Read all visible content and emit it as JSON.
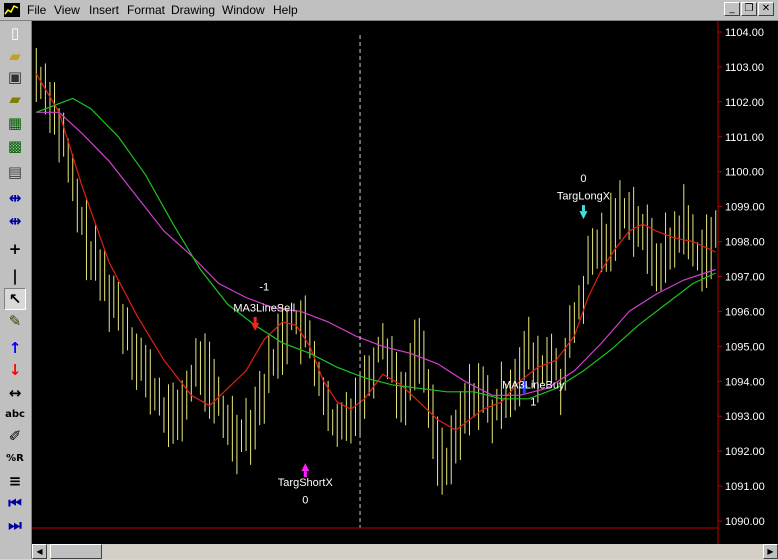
{
  "menu": {
    "items": [
      {
        "label": "File",
        "name": "menu-file"
      },
      {
        "label": "View",
        "name": "menu-view"
      },
      {
        "label": "Insert",
        "name": "menu-insert"
      },
      {
        "label": "Format",
        "name": "menu-format"
      },
      {
        "label": "Drawing",
        "name": "menu-drawing"
      },
      {
        "label": "Window",
        "name": "menu-window"
      },
      {
        "label": "Help",
        "name": "menu-help"
      }
    ]
  },
  "window_controls": [
    "minimize",
    "restore",
    "close"
  ],
  "toolbar": {
    "tools": [
      {
        "icon": "new-document-icon",
        "glyph": "▯",
        "color": "#ffffff"
      },
      {
        "icon": "open-folder-icon",
        "glyph": "▰",
        "color": "#c8a020"
      },
      {
        "icon": "save-stack-icon",
        "glyph": "▣",
        "color": "#303030"
      },
      {
        "icon": "open-workspace-icon",
        "glyph": "▰",
        "color": "#808000"
      },
      {
        "icon": "chart-window-icon",
        "glyph": "▦",
        "color": "#006000"
      },
      {
        "icon": "indicator-icon",
        "glyph": "▩",
        "color": "#006000"
      },
      {
        "icon": "print-icon",
        "glyph": "▤",
        "color": "#404040"
      },
      {
        "icon": "zoom-in-icon",
        "glyph": "⇹",
        "color": "#0000a0"
      },
      {
        "icon": "zoom-out-icon",
        "glyph": "⇹",
        "color": "#0000a0"
      },
      {
        "icon": "crosshair-icon",
        "glyph": "+",
        "color": "#000000"
      },
      {
        "icon": "vertical-line-icon",
        "glyph": "|",
        "color": "#000000"
      },
      {
        "icon": "pointer-icon",
        "glyph": "↖",
        "color": "#000000"
      },
      {
        "icon": "note-icon",
        "glyph": "✎",
        "color": "#404000"
      },
      {
        "icon": "buy-arrow-icon",
        "glyph": "↑",
        "color": "#0000ff"
      },
      {
        "icon": "sell-arrow-icon",
        "glyph": "↓",
        "color": "#ff0000"
      },
      {
        "icon": "horizontal-arrows-icon",
        "glyph": "↔",
        "color": "#000000"
      },
      {
        "icon": "text-tool-icon",
        "glyph": "abc",
        "color": "#000000"
      },
      {
        "icon": "pencil-icon",
        "glyph": "✐",
        "color": "#000000"
      },
      {
        "icon": "percent-retracement-icon",
        "glyph": "%R",
        "color": "#000000"
      },
      {
        "icon": "equal-lines-icon",
        "glyph": "≡",
        "color": "#000000"
      },
      {
        "icon": "first-bar-icon",
        "glyph": "⏮",
        "color": "#0000a0"
      },
      {
        "icon": "last-bar-icon",
        "glyph": "⏭",
        "color": "#0000a0"
      }
    ]
  },
  "colors": {
    "background": "#000000",
    "bars": "#e8e87a",
    "ma_fast": "#e02010",
    "ma_mid": "#d040d0",
    "ma_slow": "#20c020",
    "axis": "#c00000",
    "label_text": "#ffffff"
  },
  "chart_data": {
    "type": "line",
    "instrument": "",
    "y_axis": {
      "ticks": [
        1090,
        1091,
        1092,
        1093,
        1094,
        1095,
        1096,
        1097,
        1098,
        1099,
        1100,
        1101,
        1102,
        1103,
        1104
      ],
      "tick_labels": [
        "1090.00",
        "1091.00",
        "1092.00",
        "1093.00",
        "1094.00",
        "1095.00",
        "1096.00",
        "1097.00",
        "1098.00",
        "1099.00",
        "1100.00",
        "1101.00",
        "1102.00",
        "1103.00",
        "1104.00"
      ],
      "ylim": [
        1089.8,
        1104.2
      ]
    },
    "bar_count": 150,
    "close_path": [
      [
        0,
        1102.8
      ],
      [
        3,
        1102.2
      ],
      [
        6,
        1100.8
      ],
      [
        9,
        1099.0
      ],
      [
        12,
        1097.6
      ],
      [
        16,
        1096.6
      ],
      [
        20,
        1095.5
      ],
      [
        24,
        1094.2
      ],
      [
        27,
        1093.4
      ],
      [
        30,
        1092.8
      ],
      [
        33,
        1093.6
      ],
      [
        36,
        1094.6
      ],
      [
        38,
        1094.0
      ],
      [
        41,
        1093.0
      ],
      [
        44,
        1092.5
      ],
      [
        47,
        1092.8
      ],
      [
        50,
        1093.8
      ],
      [
        53,
        1095.0
      ],
      [
        56,
        1095.8
      ],
      [
        59,
        1095.4
      ],
      [
        62,
        1094.2
      ],
      [
        64,
        1093.0
      ],
      [
        66,
        1092.5
      ],
      [
        69,
        1093.2
      ],
      [
        72,
        1093.8
      ],
      [
        74,
        1094.6
      ],
      [
        76,
        1095.2
      ],
      [
        78,
        1094.6
      ],
      [
        80,
        1093.5
      ],
      [
        82,
        1094.2
      ],
      [
        84,
        1095.1
      ],
      [
        86,
        1093.6
      ],
      [
        88,
        1092.2
      ],
      [
        90,
        1091.4
      ],
      [
        92,
        1092.3
      ],
      [
        94,
        1093.2
      ],
      [
        97,
        1093.8
      ],
      [
        100,
        1093.0
      ],
      [
        103,
        1093.6
      ],
      [
        106,
        1094.4
      ],
      [
        108,
        1094.8
      ],
      [
        110,
        1094.2
      ],
      [
        113,
        1094.7
      ],
      [
        115,
        1094.0
      ],
      [
        118,
        1095.6
      ],
      [
        120,
        1096.6
      ],
      [
        122,
        1097.6
      ],
      [
        125,
        1098.0
      ],
      [
        127,
        1098.6
      ],
      [
        130,
        1099.0
      ],
      [
        133,
        1098.2
      ],
      [
        136,
        1097.4
      ],
      [
        139,
        1097.8
      ],
      [
        142,
        1098.6
      ],
      [
        145,
        1097.6
      ],
      [
        147,
        1097.8
      ],
      [
        149,
        1098.2
      ]
    ],
    "series": [
      {
        "name": "",
        "color": "#e02010",
        "path": [
          [
            0,
            1102.8
          ],
          [
            5,
            1101.7
          ],
          [
            10,
            1099.6
          ],
          [
            16,
            1097.4
          ],
          [
            22,
            1095.9
          ],
          [
            28,
            1094.6
          ],
          [
            34,
            1093.6
          ],
          [
            38,
            1093.3
          ],
          [
            42,
            1093.8
          ],
          [
            46,
            1094.3
          ],
          [
            50,
            1095.2
          ],
          [
            54,
            1095.7
          ],
          [
            57,
            1095.6
          ],
          [
            60,
            1095.0
          ],
          [
            63,
            1094.0
          ],
          [
            66,
            1093.4
          ],
          [
            69,
            1093.2
          ],
          [
            72,
            1093.5
          ],
          [
            76,
            1094.2
          ],
          [
            80,
            1093.9
          ],
          [
            84,
            1093.4
          ],
          [
            88,
            1092.9
          ],
          [
            92,
            1092.6
          ],
          [
            95,
            1092.9
          ],
          [
            98,
            1093.2
          ],
          [
            102,
            1093.4
          ],
          [
            106,
            1094.0
          ],
          [
            110,
            1094.4
          ],
          [
            114,
            1094.6
          ],
          [
            118,
            1095.3
          ],
          [
            121,
            1096.4
          ],
          [
            124,
            1097.2
          ],
          [
            127,
            1097.8
          ],
          [
            130,
            1098.3
          ],
          [
            133,
            1098.5
          ],
          [
            136,
            1098.3
          ],
          [
            140,
            1098.1
          ],
          [
            144,
            1098.0
          ],
          [
            149,
            1097.7
          ]
        ]
      },
      {
        "name": "",
        "color": "#d040d0",
        "path": [
          [
            0,
            1101.7
          ],
          [
            5,
            1101.7
          ],
          [
            10,
            1101.1
          ],
          [
            16,
            1100.3
          ],
          [
            22,
            1099.3
          ],
          [
            28,
            1098.3
          ],
          [
            34,
            1097.6
          ],
          [
            40,
            1096.8
          ],
          [
            46,
            1096.4
          ],
          [
            52,
            1096.1
          ],
          [
            58,
            1096.0
          ],
          [
            64,
            1095.7
          ],
          [
            70,
            1095.3
          ],
          [
            76,
            1095.0
          ],
          [
            82,
            1094.8
          ],
          [
            88,
            1094.5
          ],
          [
            94,
            1094.0
          ],
          [
            100,
            1093.6
          ],
          [
            106,
            1093.6
          ],
          [
            112,
            1093.8
          ],
          [
            118,
            1094.3
          ],
          [
            124,
            1095.1
          ],
          [
            130,
            1096.0
          ],
          [
            136,
            1096.5
          ],
          [
            142,
            1096.9
          ],
          [
            149,
            1097.2
          ]
        ]
      },
      {
        "name": "",
        "color": "#20c020",
        "path": [
          [
            0,
            1101.7
          ],
          [
            4,
            1101.9
          ],
          [
            8,
            1102.1
          ],
          [
            12,
            1101.8
          ],
          [
            18,
            1101.0
          ],
          [
            24,
            1099.9
          ],
          [
            30,
            1098.5
          ],
          [
            36,
            1097.2
          ],
          [
            42,
            1096.2
          ],
          [
            48,
            1095.6
          ],
          [
            54,
            1095.1
          ],
          [
            60,
            1094.8
          ],
          [
            66,
            1094.4
          ],
          [
            72,
            1094.1
          ],
          [
            78,
            1093.9
          ],
          [
            84,
            1093.8
          ],
          [
            90,
            1093.7
          ],
          [
            96,
            1093.7
          ],
          [
            102,
            1093.5
          ],
          [
            108,
            1093.5
          ],
          [
            114,
            1093.8
          ],
          [
            120,
            1094.3
          ],
          [
            126,
            1094.9
          ],
          [
            132,
            1095.6
          ],
          [
            138,
            1096.2
          ],
          [
            144,
            1096.8
          ],
          [
            149,
            1097.1
          ]
        ]
      }
    ],
    "annotations": [
      {
        "text": "-1",
        "bar": 50,
        "price": 1096.6,
        "color": "#ffffff"
      },
      {
        "text": "MA3LineSell",
        "bar": 50,
        "price": 1096.0,
        "color": "#ffffff"
      },
      {
        "text": "0",
        "bar": 120,
        "price": 1099.7,
        "color": "#ffffff"
      },
      {
        "text": "TargLongX",
        "bar": 120,
        "price": 1099.2,
        "color": "#ffffff"
      },
      {
        "text": "MA3LineBuy",
        "bar": 109,
        "price": 1093.8,
        "color": "#ffffff"
      },
      {
        "text": "1",
        "bar": 109,
        "price": 1093.3,
        "color": "#ffffff"
      },
      {
        "text": "TargShortX",
        "bar": 59,
        "price": 1091.0,
        "color": "#ffffff"
      },
      {
        "text": "0",
        "bar": 59,
        "price": 1090.5,
        "color": "#ffffff"
      }
    ],
    "signal_markers": [
      {
        "type": "sell",
        "bar": 48,
        "price": 1095.5,
        "color": "#ff2020"
      },
      {
        "type": "long-exit",
        "bar": 120,
        "price": 1098.7,
        "color": "#40e0e0"
      },
      {
        "type": "buy",
        "bar": 107,
        "price": 1094.0,
        "color": "#2040ff"
      },
      {
        "type": "short-exit",
        "bar": 59,
        "price": 1091.6,
        "color": "#ff20ff"
      }
    ],
    "dashed_cursor_bar": 71
  },
  "scrollbar": {
    "thumb_position": 0.02
  }
}
